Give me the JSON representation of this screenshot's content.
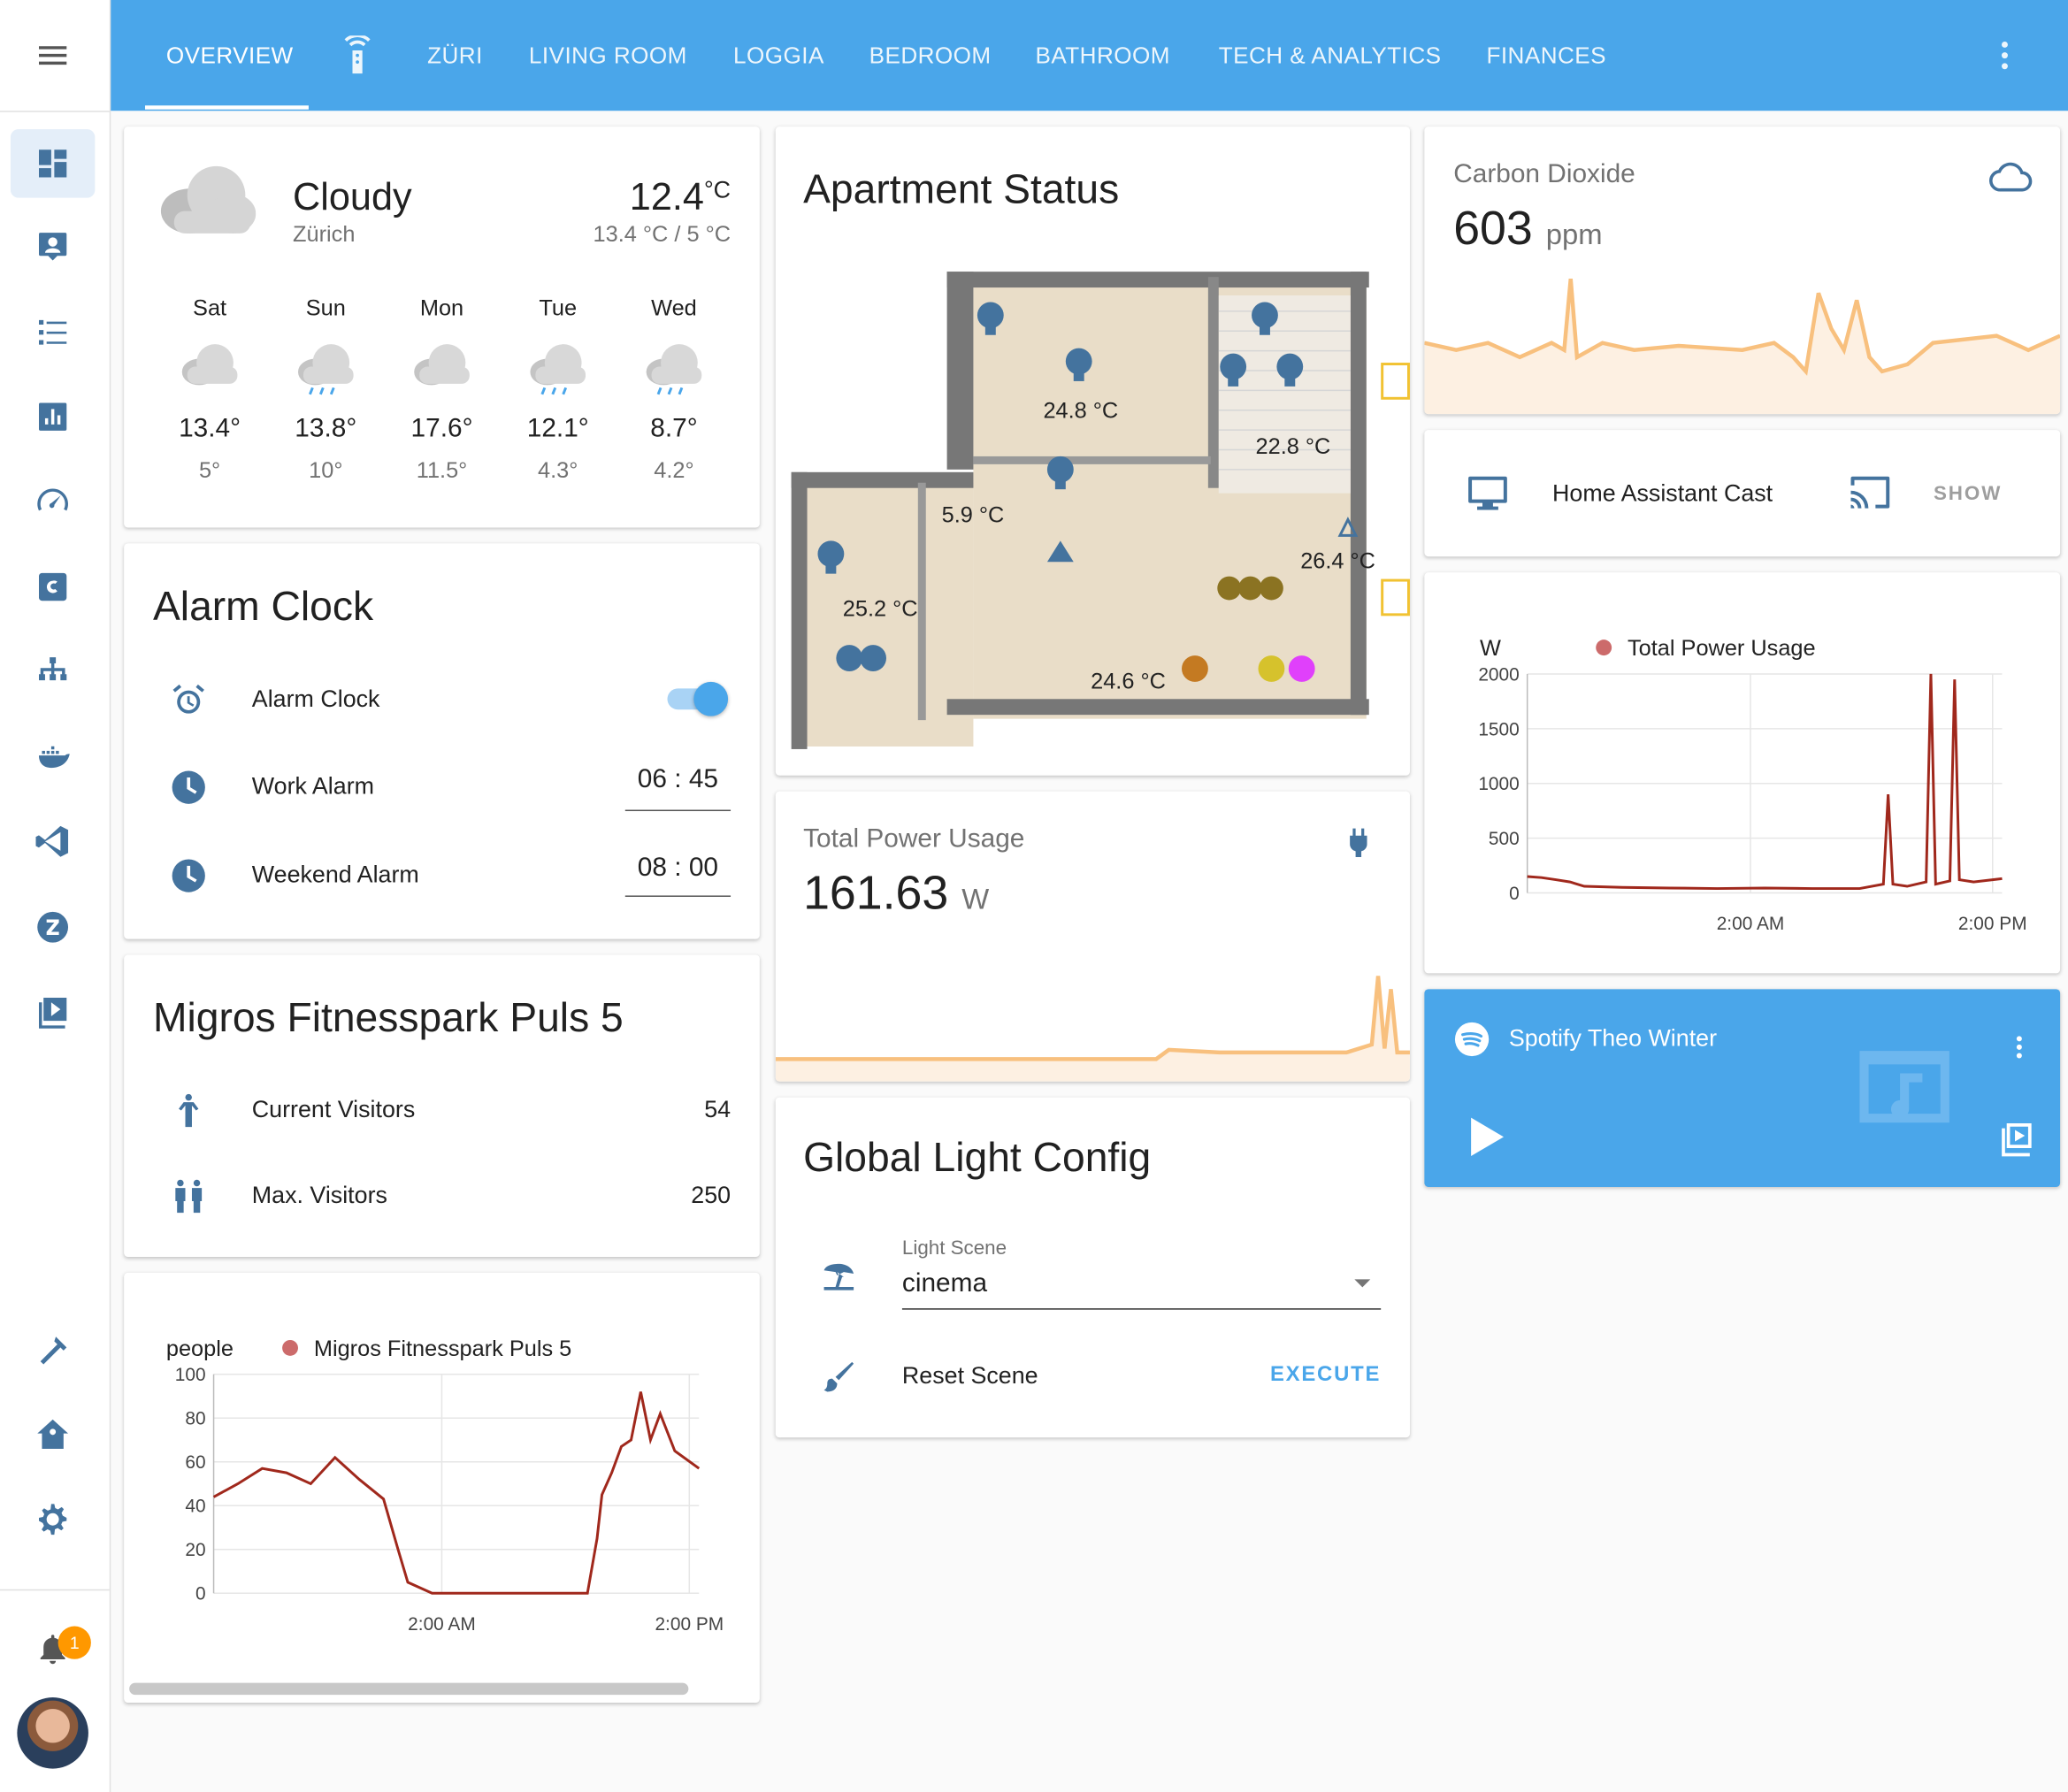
{
  "nav": {
    "tabs": [
      "OVERVIEW",
      "ZÜRI",
      "LIVING ROOM",
      "LOGGIA",
      "BEDROOM",
      "BATHROOM",
      "TECH & ANALYTICS",
      "FINANCES"
    ],
    "notification_count": "1"
  },
  "weather": {
    "condition": "Cloudy",
    "location": "Zürich",
    "temperature": "12.4",
    "unit": "°C",
    "high_low": "13.4 °C / 5 °C",
    "forecast": [
      {
        "day": "Sat",
        "icon": "cloud-icon",
        "high": "13.4°",
        "low": "5°"
      },
      {
        "day": "Sun",
        "icon": "rain-icon",
        "high": "13.8°",
        "low": "10°"
      },
      {
        "day": "Mon",
        "icon": "cloud-icon",
        "high": "17.6°",
        "low": "11.5°"
      },
      {
        "day": "Tue",
        "icon": "rain-icon",
        "high": "12.1°",
        "low": "4.3°"
      },
      {
        "day": "Wed",
        "icon": "rain-icon",
        "high": "8.7°",
        "low": "4.2°"
      }
    ]
  },
  "alarm": {
    "title": "Alarm Clock",
    "rows": [
      {
        "label": "Alarm Clock",
        "type": "toggle",
        "value": "on"
      },
      {
        "label": "Work Alarm",
        "hours": "06",
        "minutes": "45"
      },
      {
        "label": "Weekend Alarm",
        "hours": "08",
        "minutes": "00"
      }
    ]
  },
  "fitness": {
    "title": "Migros Fitnesspark Puls 5",
    "current_label": "Current Visitors",
    "current_value": "54",
    "max_label": "Max. Visitors",
    "max_value": "250"
  },
  "apartment": {
    "title": "Apartment Status",
    "temps": [
      "24.8 °C",
      "22.8 °C",
      "5.9 °C",
      "26.4 °C",
      "25.2 °C",
      "24.6 °C"
    ]
  },
  "power_sensor": {
    "title": "Total Power Usage",
    "value": "161.63",
    "unit": "W"
  },
  "light_config": {
    "title": "Global Light Config",
    "scene_label": "Light Scene",
    "scene_value": "cinema",
    "reset_label": "Reset Scene",
    "execute_label": "EXECUTE"
  },
  "co2": {
    "title": "Carbon Dioxide",
    "value": "603",
    "unit": "ppm"
  },
  "cast": {
    "label": "Home Assistant Cast",
    "action": "SHOW"
  },
  "spotify": {
    "title": "Spotify Theo Winter",
    "color": "#4aa6ea"
  },
  "colors": {
    "primary": "#4aa6ea",
    "icon": "#44739e",
    "series": "#a0281c",
    "sensor_line": "#f8c07e"
  },
  "chart_data": [
    {
      "type": "line",
      "ylabel": "people",
      "ylim": [
        0,
        100
      ],
      "yticks": [
        "100",
        "80",
        "60",
        "40",
        "20",
        "0"
      ],
      "xticks": [
        "2:00 AM",
        "2:00 PM"
      ],
      "series": [
        {
          "name": "Migros Fitnesspark Puls 5",
          "x": [
            0,
            0.05,
            0.1,
            0.15,
            0.2,
            0.25,
            0.3,
            0.35,
            0.38,
            0.4,
            0.45,
            0.5,
            0.55,
            0.6,
            0.65,
            0.7,
            0.75,
            0.77,
            0.79,
            0.8,
            0.82,
            0.84,
            0.86,
            0.88,
            0.9,
            0.92,
            0.95,
            1.0
          ],
          "values": [
            44,
            50,
            57,
            55,
            50,
            62,
            52,
            43,
            20,
            5,
            0,
            0,
            0,
            0,
            0,
            0,
            0,
            0,
            25,
            45,
            55,
            67,
            70,
            92,
            70,
            82,
            65,
            57
          ]
        }
      ]
    },
    {
      "type": "line",
      "ylabel": "W",
      "ylim": [
        0,
        2000
      ],
      "yticks": [
        "2000",
        "1500",
        "1000",
        "500",
        "0"
      ],
      "xticks": [
        "2:00 AM",
        "2:00 PM"
      ],
      "series": [
        {
          "name": "Total Power Usage",
          "x": [
            0,
            0.03,
            0.06,
            0.09,
            0.12,
            0.2,
            0.3,
            0.4,
            0.5,
            0.6,
            0.7,
            0.75,
            0.76,
            0.77,
            0.8,
            0.84,
            0.85,
            0.86,
            0.89,
            0.9,
            0.91,
            0.94,
            1.0
          ],
          "values": [
            150,
            140,
            120,
            100,
            60,
            50,
            45,
            40,
            45,
            40,
            40,
            80,
            900,
            80,
            60,
            100,
            2000,
            80,
            110,
            1950,
            120,
            100,
            130
          ]
        }
      ]
    }
  ]
}
